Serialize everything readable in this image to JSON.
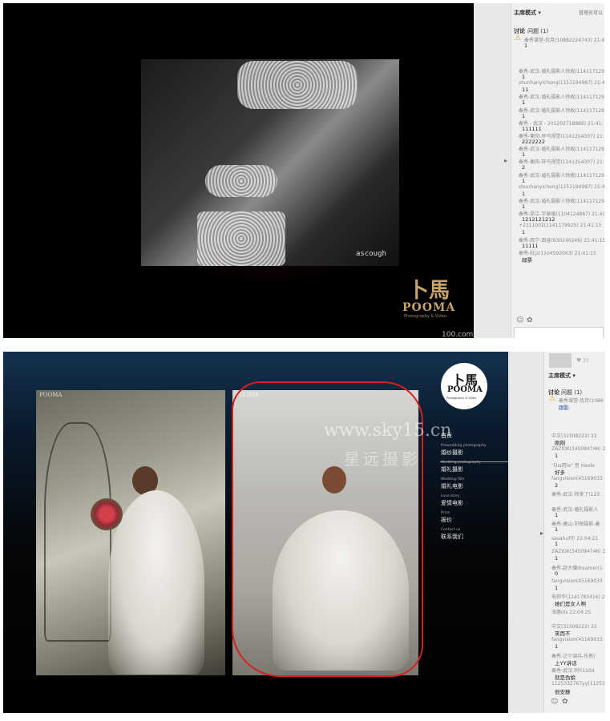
{
  "panel1": {
    "photo_credit": "ascough",
    "logo": {
      "mark": "卜馬",
      "name": "POOMA",
      "tagline": "Photography & Video"
    },
    "watermark": "100.com",
    "chat": {
      "mode_label": "主席模式",
      "admin_link": "管理员可以",
      "tabs": {
        "discuss": "讨论",
        "question": "问题 (1)"
      },
      "pinned": "秦秀课堂-优月(10882224743) 21:41:15",
      "pinned_body": "1",
      "messages": [
        {
          "header": "秦秀-武汉-婚礼摄影人徐枚(1141171296)",
          "body": "1"
        },
        {
          "header": "shunhanyichong(1151194987) 21:41:15",
          "body": "11"
        },
        {
          "header": "秦秀-武汉-婚礼摄影人徐枚(1141171296)",
          "body": "1"
        },
        {
          "header": "秦秀-武汉-婚礼摄影人徐枚(1141171296)",
          "body": "1"
        },
        {
          "header": "秦秀 - 武汉 - 201202718886) 21:41:15",
          "body": "111111"
        },
        {
          "header": "秦秀-衡阳-轩鸟视觉(1141254307) 21:41:15",
          "body": "2222222"
        },
        {
          "header": "秦秀-武汉-婚礼摄影人徐枚(1141171296)",
          "body": "1"
        },
        {
          "header": "秦秀-衡阳-轩鸟视觉(1141254307) 21:41:15",
          "body": "2"
        },
        {
          "header": "秦秀-武汉-婚礼摄影人徐枚(1141171296)",
          "body": "1"
        },
        {
          "header": "shunhanyichong(1151194987) 21:41:15",
          "body": "1"
        },
        {
          "header": "秦秀-武汉-婚礼摄影人徐枚(1141171296)",
          "body": "1"
        },
        {
          "header": "秦秀-浙江-宇泰婚(1104124867) 21:41:15",
          "body": "1212121212"
        },
        {
          "header": "+2111002(1141179925) 21:41:15",
          "body": "1"
        },
        {
          "header": "秦秀-西宁-田容(630240246) 21:41:15",
          "body": "11111"
        },
        {
          "header": "秦秀-杜jz(1104592063) 21:41:15",
          "body": "邮票"
        }
      ]
    }
  },
  "panel2": {
    "logo": {
      "mark": "卜馬",
      "name": "POOMA",
      "tagline": "Photography & Video"
    },
    "photo_logo_left": "POOMA",
    "photo_logo_right": "POOMA",
    "watermark_url": "www.sky15.cn",
    "watermark_cn": "星远摄影",
    "menu": [
      {
        "en": "",
        "cn": "首页"
      },
      {
        "en": "Prewedding photography",
        "cn": "婚纱摄影"
      },
      {
        "en": "Wedding photography",
        "cn": "婚礼摄影"
      },
      {
        "en": "Wedding film",
        "cn": "婚礼电影"
      },
      {
        "en": "Love story",
        "cn": "爱情电影"
      },
      {
        "en": "Price",
        "cn": "报价"
      },
      {
        "en": "Contact us",
        "cn": "联系我们"
      }
    ],
    "chat": {
      "mode_label": "主席模式",
      "likes": "33",
      "tabs": {
        "discuss": "讨论",
        "question": "问题 (1)"
      },
      "pinned": "秦秀课堂-优月(1086",
      "pinned_body": "跟影",
      "messages": [
        {
          "header": "中文(31508222) 22",
          "body": "刚刚"
        },
        {
          "header": "ZAZIOX(345094746) 22",
          "body": "1"
        },
        {
          "header": "\"Dia用le\" 音 Haole",
          "body": "好多"
        },
        {
          "header": "fangvision(45169033",
          "body": "2"
        },
        {
          "header": "秦秀-武汉-徐来了(123",
          "body": ""
        },
        {
          "header": "秦秀-武汉-婚礼摄影人",
          "body": "1"
        },
        {
          "header": "秦秀-唐山-印图摄影-秦",
          "body": "1"
        },
        {
          "header": "sasahuf尔 22:04:21",
          "body": "1"
        },
        {
          "header": "ZAZIOX(345094746) 22",
          "body": "1"
        },
        {
          "header": "秦秀-赵大骥dreamer(1",
          "body": "0"
        },
        {
          "header": "fangvision(45169033",
          "body": "1"
        },
        {
          "header": "电帅华(1141783416) 22",
          "body": "她们是女人啊"
        },
        {
          "header": "海惠ols 22:04:25",
          "body": ""
        },
        {
          "header": "中文(31508222) 22",
          "body": "笑而不"
        },
        {
          "header": "fangvision(45169033",
          "body": "1"
        },
        {
          "header": "秦秀-辽宁调兵-乐新(",
          "body": "上YY讲话"
        },
        {
          "header": "秦秀-武汉-阿l(1104",
          "body": "就是伪娘"
        },
        {
          "header": "1125332767yy(1125332",
          "body": "很安静"
        }
      ]
    }
  }
}
